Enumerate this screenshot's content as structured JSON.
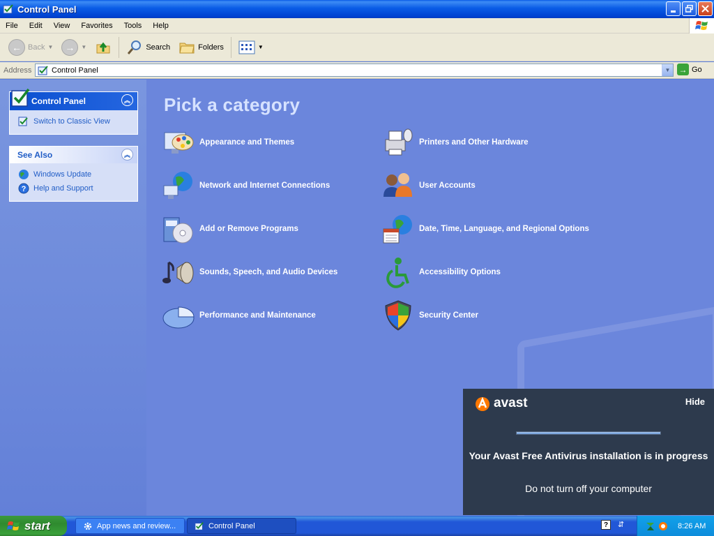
{
  "window": {
    "title": "Control Panel"
  },
  "menu": [
    "File",
    "Edit",
    "View",
    "Favorites",
    "Tools",
    "Help"
  ],
  "toolbar": {
    "back": "Back",
    "search": "Search",
    "folders": "Folders"
  },
  "address": {
    "label": "Address",
    "value": "Control Panel",
    "go": "Go"
  },
  "sidebar": {
    "control_panel": {
      "title": "Control Panel",
      "links": [
        "Switch to Classic View"
      ]
    },
    "see_also": {
      "title": "See Also",
      "links": [
        "Windows Update",
        "Help and Support"
      ]
    }
  },
  "main": {
    "heading": "Pick a category",
    "categories": [
      {
        "label": "Appearance and Themes",
        "icon": "appearance-themes-icon"
      },
      {
        "label": "Network and Internet Connections",
        "icon": "network-connections-icon"
      },
      {
        "label": "Add or Remove Programs",
        "icon": "add-remove-programs-icon"
      },
      {
        "label": "Sounds, Speech, and Audio Devices",
        "icon": "sounds-audio-icon"
      },
      {
        "label": "Performance and Maintenance",
        "icon": "performance-maintenance-icon"
      },
      {
        "label": "Printers and Other Hardware",
        "icon": "printers-hardware-icon"
      },
      {
        "label": "User Accounts",
        "icon": "user-accounts-icon"
      },
      {
        "label": "Date, Time, Language, and Regional Options",
        "icon": "date-time-globe-icon"
      },
      {
        "label": "Accessibility Options",
        "icon": "accessibility-icon"
      },
      {
        "label": "Security Center",
        "icon": "security-shield-icon"
      }
    ]
  },
  "avast": {
    "brand": "avast",
    "hide": "Hide",
    "progress": 1.0,
    "message": "Your Avast Free Antivirus installation is in progress",
    "sub": "Do not turn off your computer"
  },
  "taskbar": {
    "start": "start",
    "tasks": [
      {
        "label": "App news and review..."
      },
      {
        "label": "Control Panel"
      }
    ],
    "clock": "8:26 AM"
  },
  "colors": {
    "title_blue": "#0a5ce6",
    "main_bg": "#6b86dc",
    "avast_bg": "#2d3a4d",
    "start_green": "#3c9a3c"
  }
}
